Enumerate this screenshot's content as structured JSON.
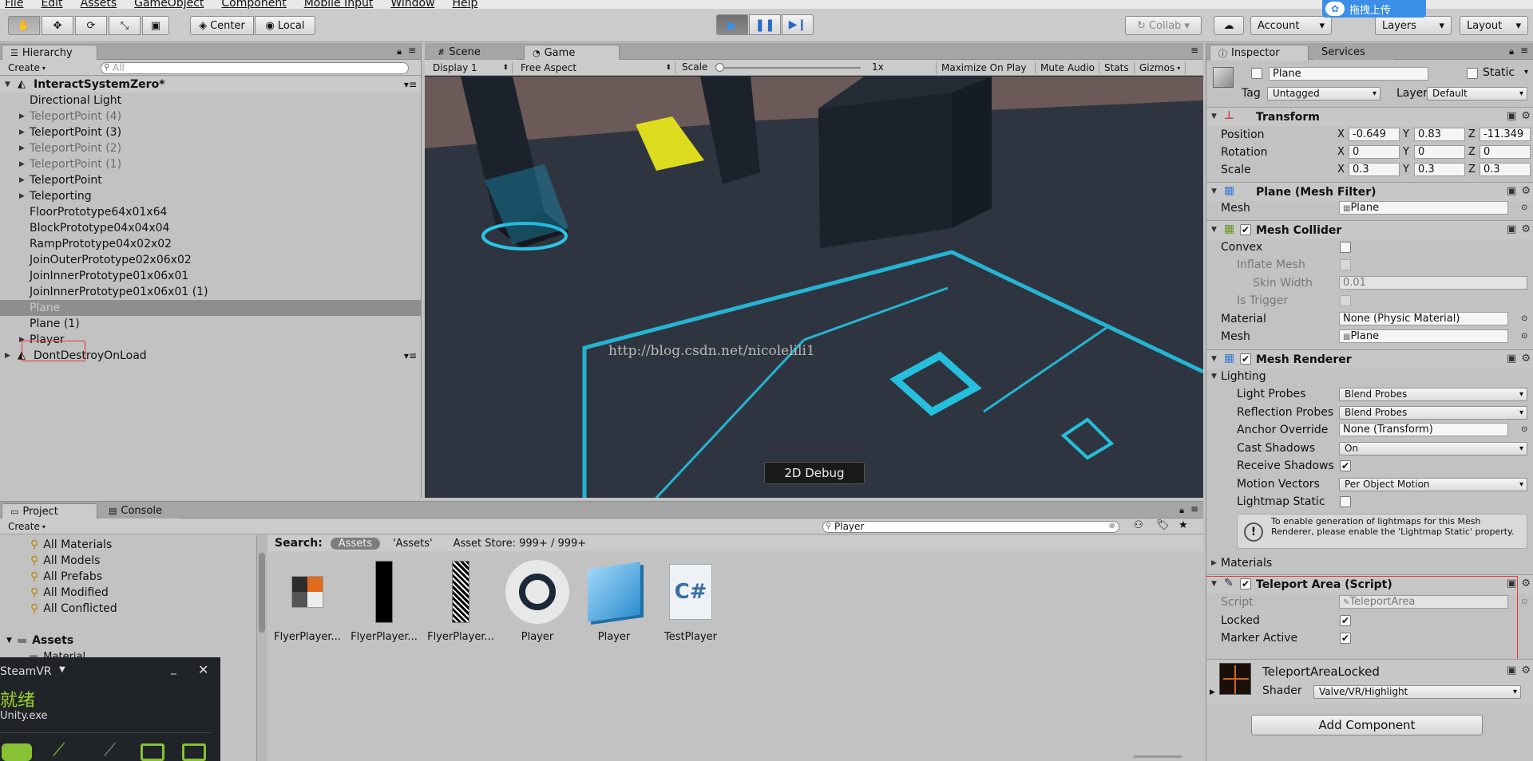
{
  "menu": [
    "File",
    "Edit",
    "Assets",
    "GameObject",
    "Component",
    "Mobile Input",
    "Window",
    "Help"
  ],
  "toolbar": {
    "pivot": "Center",
    "space": "Local",
    "collab": "Collab",
    "account": "Account",
    "layers": "Layers",
    "layout": "Layout",
    "baidu_label": "拖拽上传"
  },
  "hierarchy": {
    "tab": "Hierarchy",
    "create": "Create",
    "search_placeholder": "All",
    "scene_name": "InteractSystemZero*",
    "items": [
      {
        "label": "Directional Light",
        "expand": false,
        "grey": false
      },
      {
        "label": "TeleportPoint (4)",
        "expand": true,
        "grey": true
      },
      {
        "label": "TeleportPoint (3)",
        "expand": true,
        "grey": false
      },
      {
        "label": "TeleportPoint (2)",
        "expand": true,
        "grey": true
      },
      {
        "label": "TeleportPoint (1)",
        "expand": true,
        "grey": true
      },
      {
        "label": "TeleportPoint",
        "expand": true,
        "grey": false
      },
      {
        "label": "Teleporting",
        "expand": true,
        "grey": false
      },
      {
        "label": "FloorPrototype64x01x64",
        "expand": false,
        "grey": false
      },
      {
        "label": "BlockPrototype04x04x04",
        "expand": false,
        "grey": false
      },
      {
        "label": "RampPrototype04x02x02",
        "expand": false,
        "grey": false
      },
      {
        "label": "JoinOuterPrototype02x06x02",
        "expand": false,
        "grey": false
      },
      {
        "label": "JoinInnerPrototype01x06x01",
        "expand": false,
        "grey": false
      },
      {
        "label": "JoinInnerPrototype01x06x01 (1)",
        "expand": false,
        "grey": false
      },
      {
        "label": "Plane",
        "expand": false,
        "grey": false,
        "selected": true
      },
      {
        "label": "Plane (1)",
        "expand": false,
        "grey": false
      },
      {
        "label": "Player",
        "expand": true,
        "grey": false
      }
    ],
    "dontdestroy": "DontDestroyOnLoad"
  },
  "game": {
    "scene_tab": "Scene",
    "game_tab": "Game",
    "display": "Display 1",
    "aspect": "Free Aspect",
    "scale_label": "Scale",
    "scale_value": "1x",
    "maximize": "Maximize On Play",
    "mute": "Mute Audio",
    "stats": "Stats",
    "gizmos": "Gizmos",
    "watermark": "http://blog.csdn.net/nicolelili1",
    "debug_button": "2D Debug"
  },
  "project": {
    "tab": "Project",
    "console_tab": "Console",
    "create": "Create",
    "search_value": "Player",
    "favorites": [
      "All Materials",
      "All Models",
      "All Prefabs",
      "All Modified",
      "All Conflicted"
    ],
    "assets_folder": "Assets",
    "material_folder": "Material",
    "search_label": "Search:",
    "scope_assets": "Assets",
    "scope_quoted": "'Assets'",
    "asset_store": "Asset Store: 999+ / 999+",
    "assets": [
      {
        "label": "FlyerPlayer...",
        "icon": "material-swatch-icon"
      },
      {
        "label": "FlyerPlayer...",
        "icon": "black-texture-icon"
      },
      {
        "label": "FlyerPlayer...",
        "icon": "noise-texture-icon"
      },
      {
        "label": "Player",
        "icon": "steam-logo-icon"
      },
      {
        "label": "Player",
        "icon": "prefab-cube-icon"
      },
      {
        "label": "TestPlayer",
        "icon": "csharp-script-icon"
      }
    ]
  },
  "steamvr": {
    "title": "SteamVR",
    "status": "就绪",
    "exe": "Unity.exe"
  },
  "inspector": {
    "tab": "Inspector",
    "services_tab": "Services",
    "object_name": "Plane",
    "static_label": "Static",
    "tag_label": "Tag",
    "tag_value": "Untagged",
    "layer_label": "Layer",
    "layer_value": "Default",
    "transform": {
      "title": "Transform",
      "position_label": "Position",
      "rotation_label": "Rotation",
      "scale_label": "Scale",
      "position": [
        "-0.649",
        "0.83",
        "-11.349"
      ],
      "rotation": [
        "0",
        "0",
        "0"
      ],
      "scale": [
        "0.3",
        "0.3",
        "0.3"
      ]
    },
    "mesh_filter": {
      "title": "Plane (Mesh Filter)",
      "mesh_label": "Mesh",
      "mesh_value": "Plane"
    },
    "mesh_collider": {
      "title": "Mesh Collider",
      "convex": "Convex",
      "inflate": "Inflate Mesh",
      "skin_label": "Skin Width",
      "skin_value": "0.01",
      "trigger": "Is Trigger",
      "material_label": "Material",
      "material_value": "None (Physic Material)",
      "mesh_label": "Mesh",
      "mesh_value": "Plane"
    },
    "mesh_renderer": {
      "title": "Mesh Renderer",
      "lighting": "Lighting",
      "light_probes_label": "Light Probes",
      "light_probes_value": "Blend Probes",
      "refl_label": "Reflection Probes",
      "refl_value": "Blend Probes",
      "anchor_label": "Anchor Override",
      "anchor_value": "None (Transform)",
      "cast_label": "Cast Shadows",
      "cast_value": "On",
      "receive_label": "Receive Shadows",
      "motion_label": "Motion Vectors",
      "motion_value": "Per Object Motion",
      "lightmap_label": "Lightmap Static",
      "info": "To enable generation of lightmaps for this Mesh Renderer, please enable the 'Lightmap Static' property.",
      "materials": "Materials"
    },
    "teleport_area": {
      "title": "Teleport Area (Script)",
      "script_label": "Script",
      "script_value": "TeleportArea",
      "locked_label": "Locked",
      "marker_label": "Marker Active"
    },
    "material": {
      "name": "TeleportAreaLocked",
      "shader_label": "Shader",
      "shader_value": "Valve/VR/Highlight"
    },
    "add_component": "Add Component"
  }
}
